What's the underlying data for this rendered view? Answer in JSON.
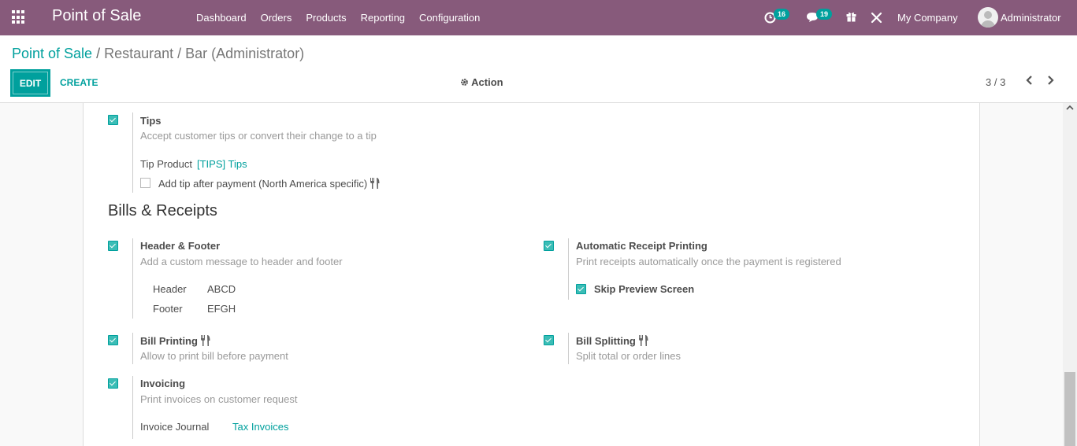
{
  "navbar": {
    "brand": "Point of Sale",
    "menu": [
      "Dashboard",
      "Orders",
      "Products",
      "Reporting",
      "Configuration"
    ],
    "activity_count": "16",
    "messages_count": "19",
    "company": "My Company",
    "user": "Administrator",
    "bg_color": "#875a7b"
  },
  "breadcrumb": {
    "root": "Point of Sale",
    "current": "Restaurant / Bar (Administrator)"
  },
  "buttons": {
    "edit": "EDIT",
    "create": "CREATE",
    "action": "Action"
  },
  "pager": {
    "value": "3 / 3"
  },
  "tips": {
    "label": "Tips",
    "description": "Accept customer tips or convert their change to a tip",
    "checked": true,
    "tip_product_label": "Tip Product",
    "tip_product_value": "[TIPS] Tips",
    "after_payment_label": "Add tip after payment (North America specific)",
    "after_payment_checked": false
  },
  "section_bills": {
    "title": "Bills & Receipts"
  },
  "header_footer": {
    "label": "Header & Footer",
    "description": "Add a custom message to header and footer",
    "checked": true,
    "header_label": "Header",
    "header_value": "ABCD",
    "footer_label": "Footer",
    "footer_value": "EFGH"
  },
  "auto_receipt": {
    "label": "Automatic Receipt Printing",
    "description": "Print receipts automatically once the payment is registered",
    "checked": true,
    "skip_preview_label": "Skip Preview Screen",
    "skip_preview_checked": true
  },
  "bill_printing": {
    "label": "Bill Printing",
    "description": "Allow to print bill before payment",
    "checked": true
  },
  "bill_splitting": {
    "label": "Bill Splitting",
    "description": "Split total or order lines",
    "checked": true
  },
  "invoicing": {
    "label": "Invoicing",
    "description": "Print invoices on customer request",
    "checked": true,
    "journal_label": "Invoice Journal",
    "journal_value": "Tax Invoices"
  },
  "accent_color": "#00a09d"
}
